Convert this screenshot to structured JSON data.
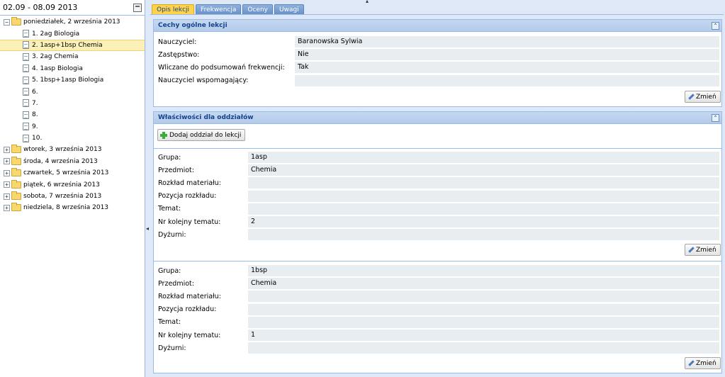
{
  "left": {
    "week_range": "02.09 - 08.09 2013",
    "days": [
      {
        "label": "poniedziałek, 2 września 2013",
        "expanded": true,
        "lessons": [
          {
            "label": "1. 2ag Biologia",
            "selected": false
          },
          {
            "label": "2. 1asp+1bsp Chemia",
            "selected": true
          },
          {
            "label": "3. 2ag Chemia",
            "selected": false
          },
          {
            "label": "4. 1asp Biologia",
            "selected": false
          },
          {
            "label": "5. 1bsp+1asp Biologia",
            "selected": false
          },
          {
            "label": "6.",
            "selected": false
          },
          {
            "label": "7.",
            "selected": false
          },
          {
            "label": "8.",
            "selected": false
          },
          {
            "label": "9.",
            "selected": false
          },
          {
            "label": "10.",
            "selected": false
          }
        ]
      },
      {
        "label": "wtorek, 3 września 2013",
        "expanded": false
      },
      {
        "label": "środa, 4 września 2013",
        "expanded": false
      },
      {
        "label": "czwartek, 5 września 2013",
        "expanded": false
      },
      {
        "label": "piątek, 6 września 2013",
        "expanded": false
      },
      {
        "label": "sobota, 7 września 2013",
        "expanded": false
      },
      {
        "label": "niedziela, 8 września 2013",
        "expanded": false
      }
    ]
  },
  "tabs": [
    "Opis lekcji",
    "Frekwencja",
    "Oceny",
    "Uwagi"
  ],
  "general": {
    "title": "Cechy ogólne lekcji",
    "fields": [
      {
        "label": "Nauczyciel:",
        "value": "Baranowska Sylwia"
      },
      {
        "label": "Zastępstwo:",
        "value": "Nie"
      },
      {
        "label": "Wliczane do podsumowań frekwencji:",
        "value": "Tak"
      },
      {
        "label": "Nauczyciel wspomagający:",
        "value": ""
      }
    ],
    "edit_label": "Zmień"
  },
  "classes": {
    "title": "Właściwości dla oddziałów",
    "add_label": "Dodaj oddział do lekcji",
    "groups": [
      {
        "fields": [
          {
            "label": "Grupa:",
            "value": "1asp"
          },
          {
            "label": "Przedmiot:",
            "value": "Chemia"
          },
          {
            "label": "Rozkład materiału:",
            "value": ""
          },
          {
            "label": "Pozycja rozkładu:",
            "value": ""
          },
          {
            "label": "Temat:",
            "value": ""
          },
          {
            "label": "Nr kolejny tematu:",
            "value": "2"
          },
          {
            "label": "Dyżurni:",
            "value": ""
          }
        ],
        "edit_label": "Zmień"
      },
      {
        "fields": [
          {
            "label": "Grupa:",
            "value": "1bsp"
          },
          {
            "label": "Przedmiot:",
            "value": "Chemia"
          },
          {
            "label": "Rozkład materiału:",
            "value": ""
          },
          {
            "label": "Pozycja rozkładu:",
            "value": ""
          },
          {
            "label": "Temat:",
            "value": ""
          },
          {
            "label": "Nr kolejny tematu:",
            "value": "1"
          },
          {
            "label": "Dyżurni:",
            "value": ""
          }
        ],
        "edit_label": "Zmień"
      }
    ]
  }
}
